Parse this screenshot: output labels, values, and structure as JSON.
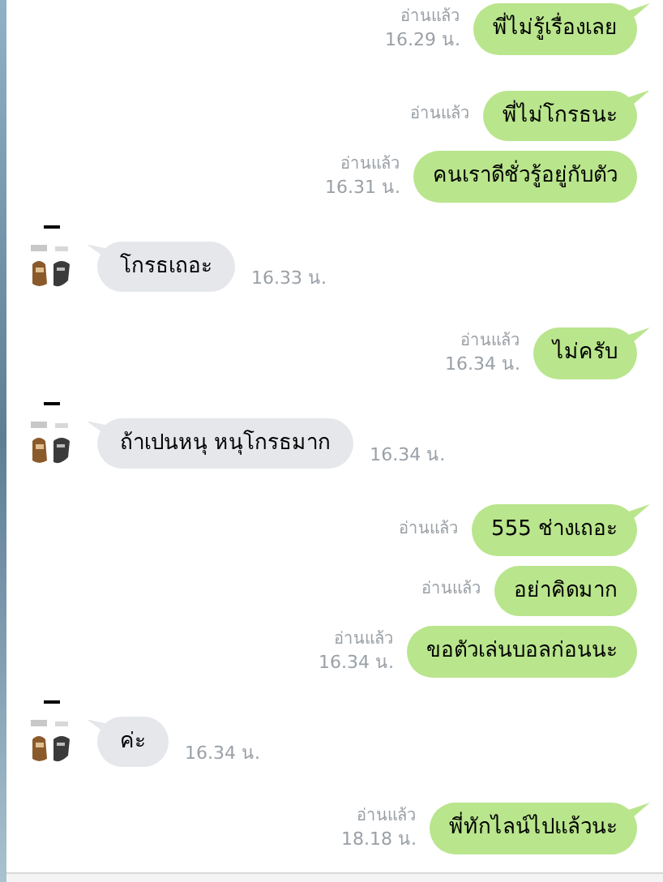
{
  "messages": [
    {
      "kind": "outgoing",
      "tail": true,
      "text": "พี่ไม่รู้เรื่องเลย",
      "read": "อ่านแล้ว",
      "time": "16.29 น."
    },
    {
      "kind": "outgoing",
      "tail": true,
      "text": "พี่ไม่โกรธนะ",
      "read": "อ่านแล้ว"
    },
    {
      "kind": "outgoing",
      "tail": false,
      "text": "คนเราดีชั่วรู้อยู่กับตัว",
      "read": "อ่านแล้ว",
      "time": "16.31 น."
    },
    {
      "kind": "incoming",
      "tail": true,
      "text": "โกรธเถอะ",
      "time": "16.33 น."
    },
    {
      "kind": "outgoing",
      "tail": true,
      "text": "ไม่ครับ",
      "read": "อ่านแล้ว",
      "time": "16.34 น."
    },
    {
      "kind": "incoming",
      "tail": true,
      "text": "ถ้าเปนหนุ หนุโกรธมาก",
      "time": "16.34 น."
    },
    {
      "kind": "outgoing",
      "tail": true,
      "text": "555 ช่างเถอะ",
      "read": "อ่านแล้ว"
    },
    {
      "kind": "outgoing",
      "tail": false,
      "text": "อย่าคิดมาก",
      "read": "อ่านแล้ว"
    },
    {
      "kind": "outgoing",
      "tail": false,
      "text": "ขอตัวเล่นบอลก่อนนะ",
      "read": "อ่านแล้ว",
      "time": "16.34 น."
    },
    {
      "kind": "incoming",
      "tail": true,
      "text": "ค่ะ",
      "time": "16.34 น."
    },
    {
      "kind": "outgoing",
      "tail": true,
      "text": "พี่ทักไลน์ไปแล้วนะ",
      "read": "อ่านแล้ว",
      "time": "18.18 น."
    }
  ]
}
